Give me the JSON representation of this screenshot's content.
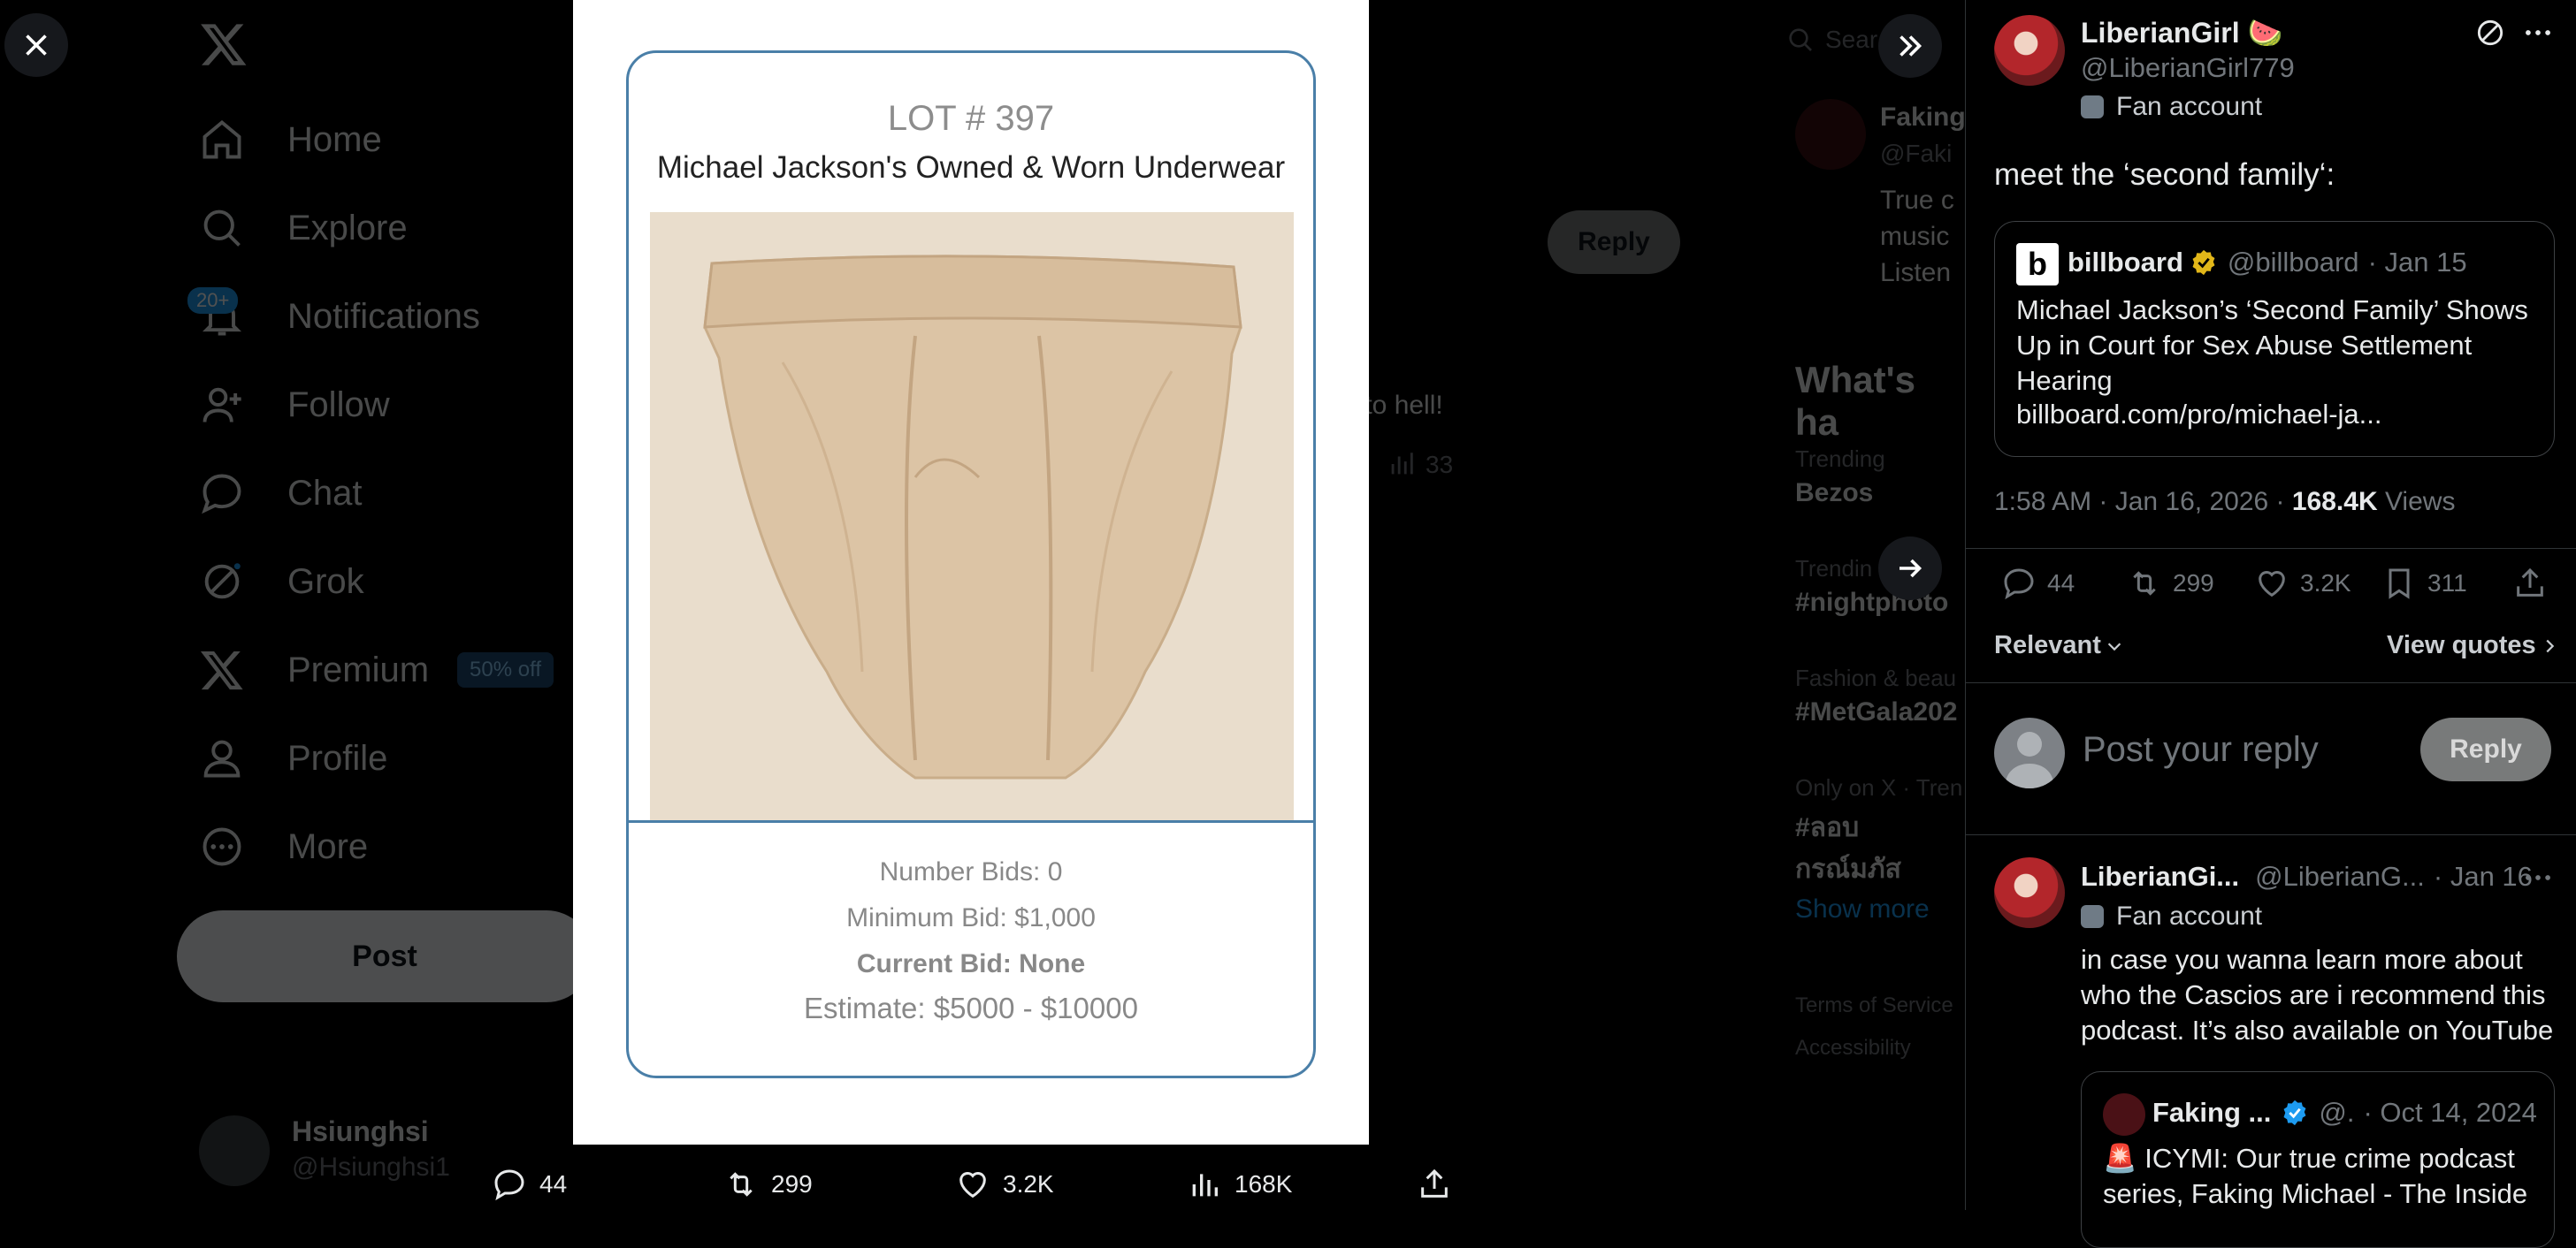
{
  "nav": {
    "items": [
      {
        "label": "Home",
        "icon": "home-icon"
      },
      {
        "label": "Explore",
        "icon": "search-icon"
      },
      {
        "label": "Notifications",
        "icon": "bell-icon"
      },
      {
        "label": "Follow",
        "icon": "follow-icon"
      },
      {
        "label": "Chat",
        "icon": "chat-icon"
      },
      {
        "label": "Grok",
        "icon": "grok-icon"
      },
      {
        "label": "Premium",
        "icon": "x-logo-icon"
      },
      {
        "label": "Profile",
        "icon": "profile-icon"
      },
      {
        "label": "More",
        "icon": "more-icon"
      }
    ],
    "notifications_badge": "20+",
    "premium_badge": "50% off",
    "post_label": "Post",
    "account_name": "Hsiunghsi",
    "account_handle": "@Hsiunghsi1"
  },
  "background": {
    "reply_label": "Reply",
    "tweet_snippet": "y to hell!",
    "views_count": "33",
    "search_placeholder": "Sear",
    "side_profile_name": "Faking",
    "side_profile_handle": "@Faki",
    "side_profile_bio": [
      "True c",
      "music",
      "Listen"
    ],
    "whats_happening": "What's ha",
    "trends": [
      {
        "context": "Trending",
        "name": "Bezos"
      },
      {
        "context": "Trendin",
        "name": "#nightphoto"
      },
      {
        "context": "Fashion & beau",
        "name": "#MetGala202"
      },
      {
        "context": "Only on X · Tren",
        "name": "#ลอบกรณ์มภัส"
      }
    ],
    "show_more": "Show more",
    "footer": [
      "Terms of Service",
      "Accessibility"
    ]
  },
  "media": {
    "lot": "LOT # 397",
    "title": "Michael Jackson's Owned & Worn Underwear",
    "number_bids": "Number Bids: 0",
    "minimum_bid": "Minimum Bid: $1,000",
    "current_bid": "Current Bid: None",
    "estimate": "Estimate: $5000 - $10000"
  },
  "media_actions": {
    "replies": "44",
    "reposts": "299",
    "likes": "3.2K",
    "views": "168K"
  },
  "panel": {
    "author_name": "LiberianGirl 🍉",
    "author_handle": "@LiberianGirl779",
    "fan_account": "Fan account",
    "tweet_text": "meet the ‘second family‘:",
    "quote": {
      "source_logo": "b",
      "name": "billboard",
      "handle": "@billboard",
      "date": "· Jan 15",
      "text": "Michael Jackson’s ‘Second Family’ Shows Up in Court for Sex Abuse Settlement Hearing",
      "link": "billboard.com/pro/michael-ja..."
    },
    "timestamp": "1:58 AM · Jan 16, 2026 · ",
    "views_count": "168.4K",
    "views_label": " Views",
    "stats": {
      "replies": "44",
      "reposts": "299",
      "likes": "3.2K",
      "bookmarks": "311"
    },
    "relevant": "Relevant",
    "view_quotes": "View quotes",
    "reply_placeholder": "Post your reply",
    "reply_button": "Reply",
    "reply": {
      "name": "LiberianGi...",
      "handle": "@LiberianG...",
      "date": "· Jan 16",
      "fan_account": "Fan account",
      "text": "in case you wanna learn more about who the Cascios are i recommend this podcast. It’s also available on YouTube",
      "quote_name": "Faking ...",
      "quote_handle": "@.",
      "quote_date": "· Oct 14, 2024",
      "quote_text": "🚨 ICYMI: Our true crime podcast series, Faking Michael - The Inside"
    }
  },
  "colors": {
    "accent": "#1d9bf0",
    "verified_gold": "#e2b719",
    "card_border": "#4a7fa8"
  }
}
